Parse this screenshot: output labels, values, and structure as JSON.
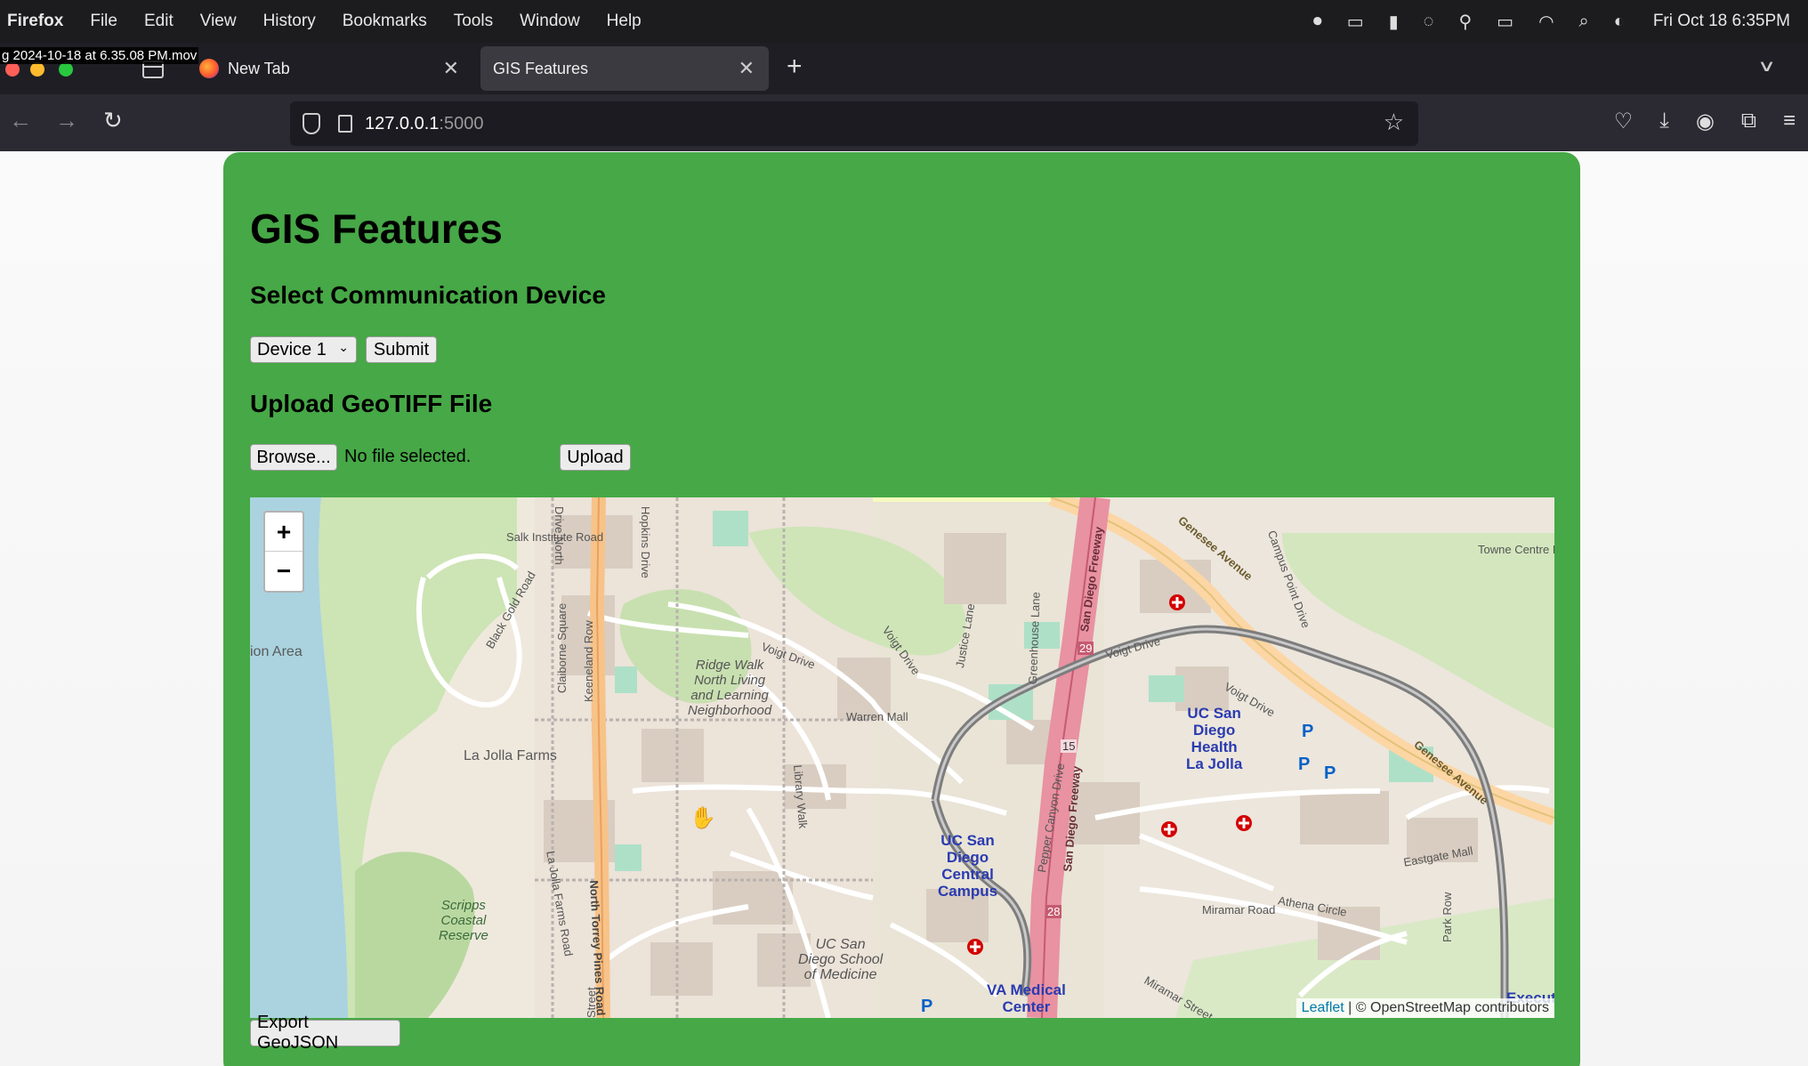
{
  "menubar": {
    "app": "Firefox",
    "items": [
      "File",
      "Edit",
      "View",
      "History",
      "Bookmarks",
      "Tools",
      "Window",
      "Help"
    ],
    "clock": "Fri Oct 18  6:35PM"
  },
  "recording_label": "g 2024-10-18 at 6.35.08 PM.mov",
  "tabs": [
    {
      "label": "New Tab"
    },
    {
      "label": "GIS Features"
    }
  ],
  "address": {
    "host": "127.0.0.1",
    "port": ":5000"
  },
  "page": {
    "title": "GIS Features",
    "device_section": "Select Communication Device",
    "device_selected": "Device 1",
    "submit_label": "Submit",
    "upload_section": "Upload GeoTIFF File",
    "browse_label": "Browse...",
    "file_status": "No file selected.",
    "upload_label": "Upload",
    "export_label": "Export GeoJSON"
  },
  "map": {
    "zoom_in": "+",
    "zoom_out": "−",
    "attribution_link": "Leaflet",
    "attribution_text": " | © OpenStreetMap contributors",
    "labels": {
      "salk": "Salk Institute Road",
      "black_gold": "Black Gold Road",
      "ion_area": "ion Area",
      "la_jolla_farms": "La Jolla Farms",
      "claiborne": "Claiborne Square",
      "keeneland": "Keeneland Row",
      "la_jolla_farms_road": "La Jolla Farms Road",
      "north_torrey": "North Torrey Pines Road",
      "scripps": "Scripps\nCoastal\nReserve",
      "ridge_walk": "Ridge Walk\nNorth Living\nand Learning\nNeighborhood",
      "hopkins": "Hopkins Drive",
      "voigt1": "Voigt Drive",
      "voigt2": "Voigt Drive",
      "voigt3": "Voigt Drive",
      "voigt4": "Voigt Drive",
      "warren": "Warren Mall",
      "library": "Library Walk",
      "justice": "Justice Lane",
      "greenhouse": "Greenhouse Lane",
      "sd_freeway1": "San Diego Freeway",
      "sd_freeway2": "San Diego Freeway",
      "pepper": "Pepper Canyon Drive",
      "genesee1": "Genesee Avenue",
      "genesee2": "Genesee Avenue",
      "campus_point": "Campus Point Drive",
      "towne_centre": "Towne Centre Drive",
      "ucsd_health": "UC San\nDiego\nHealth\nLa Jolla",
      "ucsd_central": "UC San\nDiego\nCentral\nCampus",
      "ucsd_med": "UC San\nDiego School\nof Medicine",
      "va_medical": "VA Medical\nCenter",
      "eastgate": "Eastgate Mall",
      "miramar_street": "Miramar Street",
      "athena": "Athena Circle",
      "miramar_road": "Miramar Road",
      "park_row": "Park Row",
      "executive": "Executive",
      "hwy29": "29",
      "hwy15": "15",
      "hwy28": "28",
      "drive_north": "Drive North",
      "street": "Street"
    }
  }
}
